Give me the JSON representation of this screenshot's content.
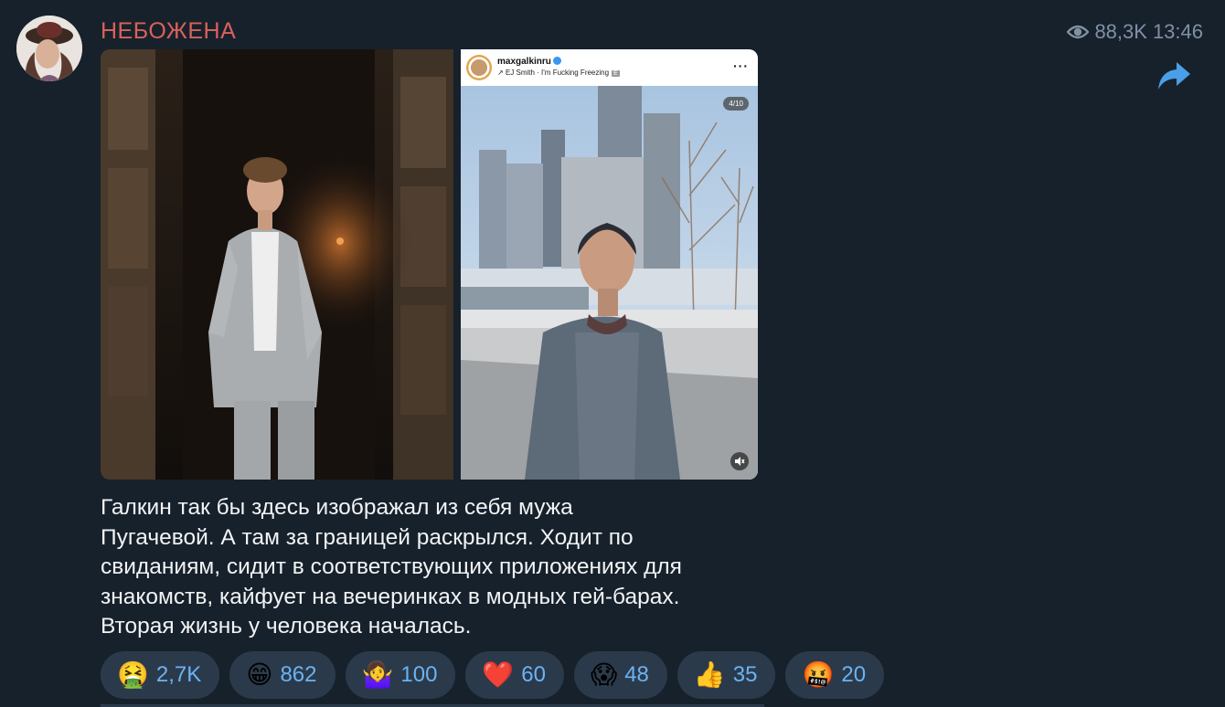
{
  "channel": {
    "name": "НЕБОЖЕНА"
  },
  "post": {
    "views": "88,3K",
    "time": "13:46",
    "caption": "Галкин так бы здесь изображал из себя мужа\nПугачевой. А там за границей раскрылся. Ходит по\nсвиданиям, сидит в соответствующих приложениях для\nзнакомств, кайфует на вечеринках в модных гей-барах.\nВторая жизнь у человека началась."
  },
  "instagram": {
    "username": "maxgalkinru",
    "track": "EJ Smith · I'm Fucking Freezing",
    "explicit_badge": "E",
    "counter": "4/10"
  },
  "reactions": [
    {
      "emoji": "🤮",
      "count": "2,7K",
      "icon": "vomiting-face-icon"
    },
    {
      "emoji": "😁",
      "count": "862",
      "icon": "grinning-face-icon"
    },
    {
      "emoji": "🤷‍♀️",
      "count": "100",
      "icon": "shrug-icon"
    },
    {
      "emoji": "❤️",
      "count": "60",
      "icon": "red-heart-icon"
    },
    {
      "emoji": "😱",
      "count": "48",
      "icon": "screaming-face-icon"
    },
    {
      "emoji": "👍",
      "count": "35",
      "icon": "thumbs-up-icon"
    },
    {
      "emoji": "🤬",
      "count": "20",
      "icon": "cursing-face-icon"
    }
  ],
  "colors": {
    "background": "#17212b",
    "channel_name": "#d9615b",
    "meta_text": "#7f91a4",
    "forward_icon": "#4a9fe8",
    "reaction_bg": "#2b3a4b",
    "reaction_count": "#6ab3f3",
    "caption_text": "#f2f4f6"
  }
}
